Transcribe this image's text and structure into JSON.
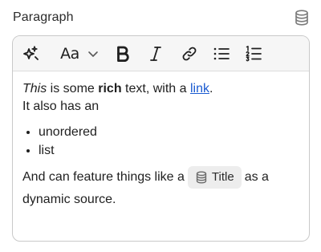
{
  "field": {
    "label": "Paragraph",
    "source_icon": "database-icon"
  },
  "toolbar": {
    "ai_icon": "sparkle-icon",
    "font_label": "Aa",
    "chevron_icon": "chevron-down-icon",
    "bold_icon": "bold-icon",
    "italic_icon": "italic-icon",
    "link_icon": "link-icon",
    "bullet_list_icon": "bullet-list-icon",
    "numbered_list_icon": "numbered-list-icon"
  },
  "content": {
    "p1": {
      "italic": "This",
      "t1": " is some ",
      "bold": "rich",
      "t2": " text, with a ",
      "link": "link",
      "t3": "."
    },
    "p2": "It also has an",
    "list": [
      "unordered",
      "list"
    ],
    "p3": {
      "before": "And can feature things like a",
      "chip_label": "Title",
      "chip_icon": "database-icon",
      "after": "as a dynamic source."
    }
  },
  "colors": {
    "link": "#1a5bd1",
    "toolbar_bg": "#f6f6f6",
    "border": "#c9c9c9",
    "chip_bg": "#ededed"
  }
}
